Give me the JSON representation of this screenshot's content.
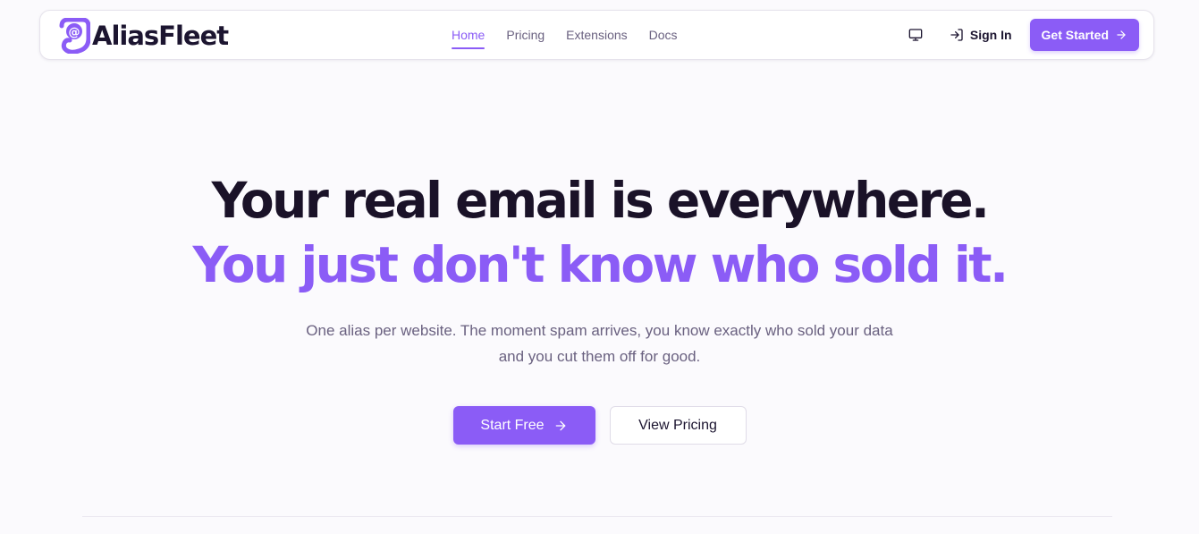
{
  "brand": {
    "name": "AliasFleet",
    "logo_icon": "at-sign-logo-icon",
    "color": "#8b5cf6"
  },
  "nav": {
    "links": [
      {
        "label": "Home",
        "active": true
      },
      {
        "label": "Pricing",
        "active": false
      },
      {
        "label": "Extensions",
        "active": false
      },
      {
        "label": "Docs",
        "active": false
      }
    ],
    "theme_icon": "monitor-icon",
    "sign_in_label": "Sign In",
    "sign_in_icon": "log-in-icon",
    "get_started_label": "Get Started",
    "get_started_icon": "arrow-right-icon"
  },
  "hero": {
    "headline_line1": "Your real email is everywhere.",
    "headline_line2": "You just don't know who sold it.",
    "subtext": "One alias per website. The moment spam arrives, you know exactly who sold your data and you cut them off for good.",
    "primary_cta": "Start Free",
    "secondary_cta": "View Pricing"
  },
  "colors": {
    "accent": "#8b5cf6",
    "heading": "#1a1228",
    "muted": "#6a6180",
    "background": "#fbfafd"
  }
}
